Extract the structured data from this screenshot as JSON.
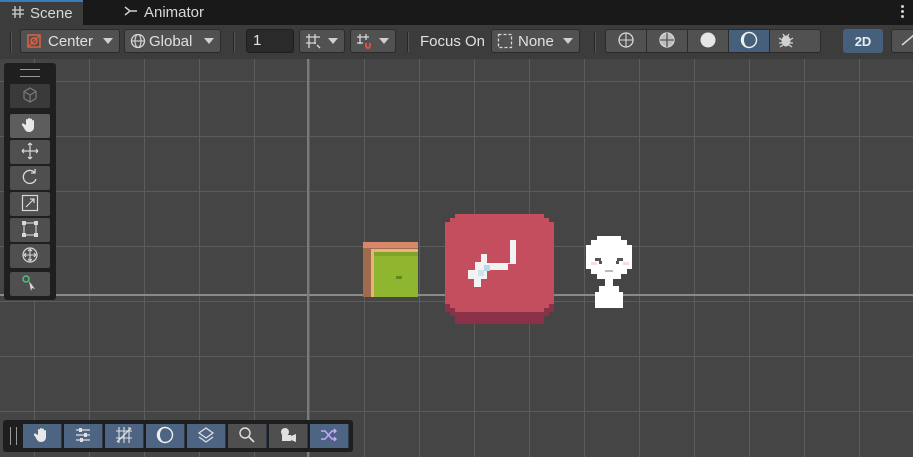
{
  "tabs": [
    {
      "label": "Scene",
      "icon": "grid-icon"
    },
    {
      "label": "Animator",
      "icon": "animator-icon"
    }
  ],
  "toolbar": {
    "pivot_mode": "Center",
    "pivot_rotation": "Global",
    "grid_size_value": "1",
    "focus_on_label": "Focus On",
    "focus_value": "None",
    "mode_2d_label": "2D"
  },
  "tools": [
    "view-hand",
    "move",
    "rotate",
    "scale",
    "rect",
    "transform",
    "custom-tool"
  ],
  "overlay_tools": [
    "hand",
    "sliders",
    "grid",
    "shading",
    "layers",
    "search",
    "camera",
    "shuffle"
  ],
  "colors": {
    "accent": "#46607c",
    "tab_highlight": "#3a79bb",
    "red_button": "#c44e5e",
    "green_block": "#8fb62e"
  }
}
